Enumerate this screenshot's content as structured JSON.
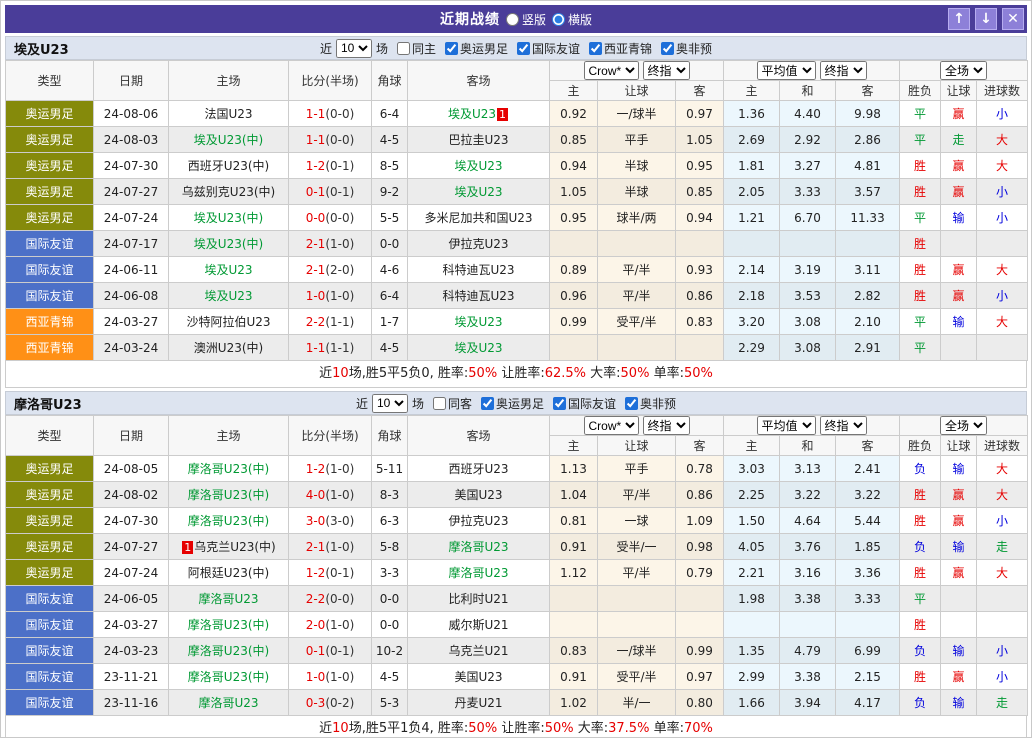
{
  "titlebar": {
    "title": "近期战绩",
    "radios": [
      {
        "label": "竖版",
        "checked": false
      },
      {
        "label": "横版",
        "checked": true
      }
    ],
    "buttons": [
      {
        "name": "move-up-button",
        "glyph": "↑"
      },
      {
        "name": "move-down-button",
        "glyph": "↓"
      },
      {
        "name": "close-button",
        "glyph": "✕"
      }
    ]
  },
  "columns": {
    "main": [
      "类型",
      "日期",
      "主场",
      "比分(半场)",
      "角球",
      "客场"
    ],
    "sub": [
      "主",
      "让球",
      "客",
      "主",
      "和",
      "客",
      "胜负",
      "让球",
      "进球数"
    ]
  },
  "controls": {
    "odds_source": "Crow*",
    "odds_final": "终指",
    "avg_source": "平均值",
    "avg_final": "终指",
    "scope": "全场"
  },
  "sections": [
    {
      "team": "埃及U23",
      "filter": {
        "near_label": "近",
        "count": "10",
        "games_label": "场",
        "same_label": "同主",
        "same_checked": false,
        "leagues": [
          {
            "label": "奥运男足",
            "checked": true
          },
          {
            "label": "国际友谊",
            "checked": true
          },
          {
            "label": "西亚青锦",
            "checked": true
          },
          {
            "label": "奥非预",
            "checked": true
          }
        ]
      },
      "rows": [
        {
          "type": "奥运男足",
          "tc": "olympic",
          "date": "24-08-06",
          "home": {
            "name": "法国U23",
            "green": false
          },
          "score": "1-1",
          "half": "(0-0)",
          "corners": "6-4",
          "away": {
            "name": "埃及U23",
            "green": true,
            "badge": "1",
            "badge_pos": "after"
          },
          "odds": [
            "0.92",
            "一/球半",
            "0.97"
          ],
          "avg": [
            "1.36",
            "4.40",
            "9.98"
          ],
          "res": [
            [
              "平",
              "g"
            ],
            [
              "赢",
              "r"
            ],
            [
              "小",
              "b"
            ]
          ]
        },
        {
          "type": "奥运男足",
          "tc": "olympic",
          "date": "24-08-03",
          "home": {
            "name": "埃及U23(中)",
            "green": true
          },
          "score": "1-1",
          "half": "(0-0)",
          "corners": "4-5",
          "away": {
            "name": "巴拉圭U23",
            "green": false
          },
          "odds": [
            "0.85",
            "平手",
            "1.05"
          ],
          "avg": [
            "2.69",
            "2.92",
            "2.86"
          ],
          "res": [
            [
              "平",
              "g"
            ],
            [
              "走",
              "g"
            ],
            [
              "大",
              "r"
            ]
          ]
        },
        {
          "type": "奥运男足",
          "tc": "olympic",
          "date": "24-07-30",
          "home": {
            "name": "西班牙U23(中)",
            "green": false
          },
          "score": "1-2",
          "half": "(0-1)",
          "corners": "8-5",
          "away": {
            "name": "埃及U23",
            "green": true
          },
          "odds": [
            "0.94",
            "半球",
            "0.95"
          ],
          "avg": [
            "1.81",
            "3.27",
            "4.81"
          ],
          "res": [
            [
              "胜",
              "r"
            ],
            [
              "赢",
              "r"
            ],
            [
              "大",
              "r"
            ]
          ]
        },
        {
          "type": "奥运男足",
          "tc": "olympic",
          "date": "24-07-27",
          "home": {
            "name": "乌兹别克U23(中)",
            "green": false
          },
          "score": "0-1",
          "half": "(0-1)",
          "corners": "9-2",
          "away": {
            "name": "埃及U23",
            "green": true
          },
          "odds": [
            "1.05",
            "半球",
            "0.85"
          ],
          "avg": [
            "2.05",
            "3.33",
            "3.57"
          ],
          "res": [
            [
              "胜",
              "r"
            ],
            [
              "赢",
              "r"
            ],
            [
              "小",
              "b"
            ]
          ]
        },
        {
          "type": "奥运男足",
          "tc": "olympic",
          "date": "24-07-24",
          "home": {
            "name": "埃及U23(中)",
            "green": true
          },
          "score": "0-0",
          "half": "(0-0)",
          "corners": "5-5",
          "away": {
            "name": "多米尼加共和国U23",
            "green": false
          },
          "odds": [
            "0.95",
            "球半/两",
            "0.94"
          ],
          "avg": [
            "1.21",
            "6.70",
            "11.33"
          ],
          "res": [
            [
              "平",
              "g"
            ],
            [
              "输",
              "b"
            ],
            [
              "小",
              "b"
            ]
          ]
        },
        {
          "type": "国际友谊",
          "tc": "friendly",
          "date": "24-07-17",
          "home": {
            "name": "埃及U23(中)",
            "green": true
          },
          "score": "2-1",
          "half": "(1-0)",
          "corners": "0-0",
          "away": {
            "name": "伊拉克U23",
            "green": false
          },
          "odds": [
            "",
            "",
            ""
          ],
          "avg": [
            "",
            "",
            ""
          ],
          "res": [
            [
              "胜",
              "r"
            ],
            [
              "",
              ""
            ],
            [
              "",
              ""
            ]
          ]
        },
        {
          "type": "国际友谊",
          "tc": "friendly",
          "date": "24-06-11",
          "home": {
            "name": "埃及U23",
            "green": true
          },
          "score": "2-1",
          "half": "(2-0)",
          "corners": "4-6",
          "away": {
            "name": "科特迪瓦U23",
            "green": false
          },
          "odds": [
            "0.89",
            "平/半",
            "0.93"
          ],
          "avg": [
            "2.14",
            "3.19",
            "3.11"
          ],
          "res": [
            [
              "胜",
              "r"
            ],
            [
              "赢",
              "r"
            ],
            [
              "大",
              "r"
            ]
          ]
        },
        {
          "type": "国际友谊",
          "tc": "friendly",
          "date": "24-06-08",
          "home": {
            "name": "埃及U23",
            "green": true
          },
          "score": "1-0",
          "half": "(1-0)",
          "corners": "6-4",
          "away": {
            "name": "科特迪瓦U23",
            "green": false
          },
          "odds": [
            "0.96",
            "平/半",
            "0.86"
          ],
          "avg": [
            "2.18",
            "3.53",
            "2.82"
          ],
          "res": [
            [
              "胜",
              "r"
            ],
            [
              "赢",
              "r"
            ],
            [
              "小",
              "b"
            ]
          ]
        },
        {
          "type": "西亚青锦",
          "tc": "westasia",
          "date": "24-03-27",
          "home": {
            "name": "沙特阿拉伯U23",
            "green": false
          },
          "score": "2-2",
          "half": "(1-1)",
          "corners": "1-7",
          "away": {
            "name": "埃及U23",
            "green": true
          },
          "odds": [
            "0.99",
            "受平/半",
            "0.83"
          ],
          "avg": [
            "3.20",
            "3.08",
            "2.10"
          ],
          "res": [
            [
              "平",
              "g"
            ],
            [
              "输",
              "b"
            ],
            [
              "大",
              "r"
            ]
          ]
        },
        {
          "type": "西亚青锦",
          "tc": "westasia",
          "date": "24-03-24",
          "home": {
            "name": "澳洲U23(中)",
            "green": false
          },
          "score": "1-1",
          "half": "(1-1)",
          "corners": "4-5",
          "away": {
            "name": "埃及U23",
            "green": true
          },
          "odds": [
            "",
            "",
            ""
          ],
          "avg": [
            "2.29",
            "3.08",
            "2.91"
          ],
          "res": [
            [
              "平",
              "g"
            ],
            [
              "",
              ""
            ],
            [
              "",
              ""
            ]
          ]
        }
      ],
      "summary": [
        {
          "t": "近",
          "r": false
        },
        {
          "t": "10",
          "r": true
        },
        {
          "t": "场,胜5平5负0, 胜率:",
          "r": false
        },
        {
          "t": "50%",
          "r": true
        },
        {
          "t": " 让胜率:",
          "r": false
        },
        {
          "t": "62.5%",
          "r": true
        },
        {
          "t": " 大率:",
          "r": false
        },
        {
          "t": "50%",
          "r": true
        },
        {
          "t": " 单率:",
          "r": false
        },
        {
          "t": "50%",
          "r": true
        }
      ]
    },
    {
      "team": "摩洛哥U23",
      "filter": {
        "near_label": "近",
        "count": "10",
        "games_label": "场",
        "same_label": "同客",
        "same_checked": false,
        "leagues": [
          {
            "label": "奥运男足",
            "checked": true
          },
          {
            "label": "国际友谊",
            "checked": true
          },
          {
            "label": "奥非预",
            "checked": true
          }
        ]
      },
      "rows": [
        {
          "type": "奥运男足",
          "tc": "olympic",
          "date": "24-08-05",
          "home": {
            "name": "摩洛哥U23(中)",
            "green": true
          },
          "score": "1-2",
          "half": "(1-0)",
          "corners": "5-11",
          "away": {
            "name": "西班牙U23",
            "green": false
          },
          "odds": [
            "1.13",
            "平手",
            "0.78"
          ],
          "avg": [
            "3.03",
            "3.13",
            "2.41"
          ],
          "res": [
            [
              "负",
              "b"
            ],
            [
              "输",
              "b"
            ],
            [
              "大",
              "r"
            ]
          ]
        },
        {
          "type": "奥运男足",
          "tc": "olympic",
          "date": "24-08-02",
          "home": {
            "name": "摩洛哥U23(中)",
            "green": true
          },
          "score": "4-0",
          "half": "(1-0)",
          "corners": "8-3",
          "away": {
            "name": "美国U23",
            "green": false
          },
          "odds": [
            "1.04",
            "平/半",
            "0.86"
          ],
          "avg": [
            "2.25",
            "3.22",
            "3.22"
          ],
          "res": [
            [
              "胜",
              "r"
            ],
            [
              "赢",
              "r"
            ],
            [
              "大",
              "r"
            ]
          ]
        },
        {
          "type": "奥运男足",
          "tc": "olympic",
          "date": "24-07-30",
          "home": {
            "name": "摩洛哥U23(中)",
            "green": true
          },
          "score": "3-0",
          "half": "(3-0)",
          "corners": "6-3",
          "away": {
            "name": "伊拉克U23",
            "green": false
          },
          "odds": [
            "0.81",
            "一球",
            "1.09"
          ],
          "avg": [
            "1.50",
            "4.64",
            "5.44"
          ],
          "res": [
            [
              "胜",
              "r"
            ],
            [
              "赢",
              "r"
            ],
            [
              "小",
              "b"
            ]
          ]
        },
        {
          "type": "奥运男足",
          "tc": "olympic",
          "date": "24-07-27",
          "home": {
            "name": "乌克兰U23(中)",
            "green": false,
            "badge": "1",
            "badge_pos": "before"
          },
          "score": "2-1",
          "half": "(1-0)",
          "corners": "5-8",
          "away": {
            "name": "摩洛哥U23",
            "green": true
          },
          "odds": [
            "0.91",
            "受半/一",
            "0.98"
          ],
          "avg": [
            "4.05",
            "3.76",
            "1.85"
          ],
          "res": [
            [
              "负",
              "b"
            ],
            [
              "输",
              "b"
            ],
            [
              "走",
              "g"
            ]
          ]
        },
        {
          "type": "奥运男足",
          "tc": "olympic",
          "date": "24-07-24",
          "home": {
            "name": "阿根廷U23(中)",
            "green": false
          },
          "score": "1-2",
          "half": "(0-1)",
          "corners": "3-3",
          "away": {
            "name": "摩洛哥U23",
            "green": true
          },
          "odds": [
            "1.12",
            "平/半",
            "0.79"
          ],
          "avg": [
            "2.21",
            "3.16",
            "3.36"
          ],
          "res": [
            [
              "胜",
              "r"
            ],
            [
              "赢",
              "r"
            ],
            [
              "大",
              "r"
            ]
          ]
        },
        {
          "type": "国际友谊",
          "tc": "friendly",
          "date": "24-06-05",
          "home": {
            "name": "摩洛哥U23",
            "green": true
          },
          "score": "2-2",
          "half": "(0-0)",
          "corners": "0-0",
          "away": {
            "name": "比利时U21",
            "green": false
          },
          "odds": [
            "",
            "",
            ""
          ],
          "avg": [
            "1.98",
            "3.38",
            "3.33"
          ],
          "res": [
            [
              "平",
              "g"
            ],
            [
              "",
              ""
            ],
            [
              "",
              ""
            ]
          ]
        },
        {
          "type": "国际友谊",
          "tc": "friendly",
          "date": "24-03-27",
          "home": {
            "name": "摩洛哥U23(中)",
            "green": true
          },
          "score": "2-0",
          "half": "(1-0)",
          "corners": "0-0",
          "away": {
            "name": "威尔斯U21",
            "green": false
          },
          "odds": [
            "",
            "",
            ""
          ],
          "avg": [
            "",
            "",
            ""
          ],
          "res": [
            [
              "胜",
              "r"
            ],
            [
              "",
              ""
            ],
            [
              "",
              ""
            ]
          ]
        },
        {
          "type": "国际友谊",
          "tc": "friendly",
          "date": "24-03-23",
          "home": {
            "name": "摩洛哥U23(中)",
            "green": true
          },
          "score": "0-1",
          "half": "(0-1)",
          "corners": "10-2",
          "away": {
            "name": "乌克兰U21",
            "green": false
          },
          "odds": [
            "0.83",
            "一/球半",
            "0.99"
          ],
          "avg": [
            "1.35",
            "4.79",
            "6.99"
          ],
          "res": [
            [
              "负",
              "b"
            ],
            [
              "输",
              "b"
            ],
            [
              "小",
              "b"
            ]
          ]
        },
        {
          "type": "国际友谊",
          "tc": "friendly",
          "date": "23-11-21",
          "home": {
            "name": "摩洛哥U23(中)",
            "green": true
          },
          "score": "1-0",
          "half": "(1-0)",
          "corners": "4-5",
          "away": {
            "name": "美国U23",
            "green": false
          },
          "odds": [
            "0.91",
            "受平/半",
            "0.97"
          ],
          "avg": [
            "2.99",
            "3.38",
            "2.15"
          ],
          "res": [
            [
              "胜",
              "r"
            ],
            [
              "赢",
              "r"
            ],
            [
              "小",
              "b"
            ]
          ]
        },
        {
          "type": "国际友谊",
          "tc": "friendly",
          "date": "23-11-16",
          "home": {
            "name": "摩洛哥U23",
            "green": true
          },
          "score": "0-3",
          "half": "(0-2)",
          "corners": "5-3",
          "away": {
            "name": "丹麦U21",
            "green": false
          },
          "odds": [
            "1.02",
            "半/一",
            "0.80"
          ],
          "avg": [
            "1.66",
            "3.94",
            "4.17"
          ],
          "res": [
            [
              "负",
              "b"
            ],
            [
              "输",
              "b"
            ],
            [
              "走",
              "g"
            ]
          ]
        }
      ],
      "summary": [
        {
          "t": "近",
          "r": false
        },
        {
          "t": "10",
          "r": true
        },
        {
          "t": "场,胜5平1负4, 胜率:",
          "r": false
        },
        {
          "t": "50%",
          "r": true
        },
        {
          "t": " 让胜率:",
          "r": false
        },
        {
          "t": "50%",
          "r": true
        },
        {
          "t": " 大率:",
          "r": false
        },
        {
          "t": "37.5%",
          "r": true
        },
        {
          "t": " 单率:",
          "r": false
        },
        {
          "t": "70%",
          "r": true
        }
      ]
    }
  ]
}
